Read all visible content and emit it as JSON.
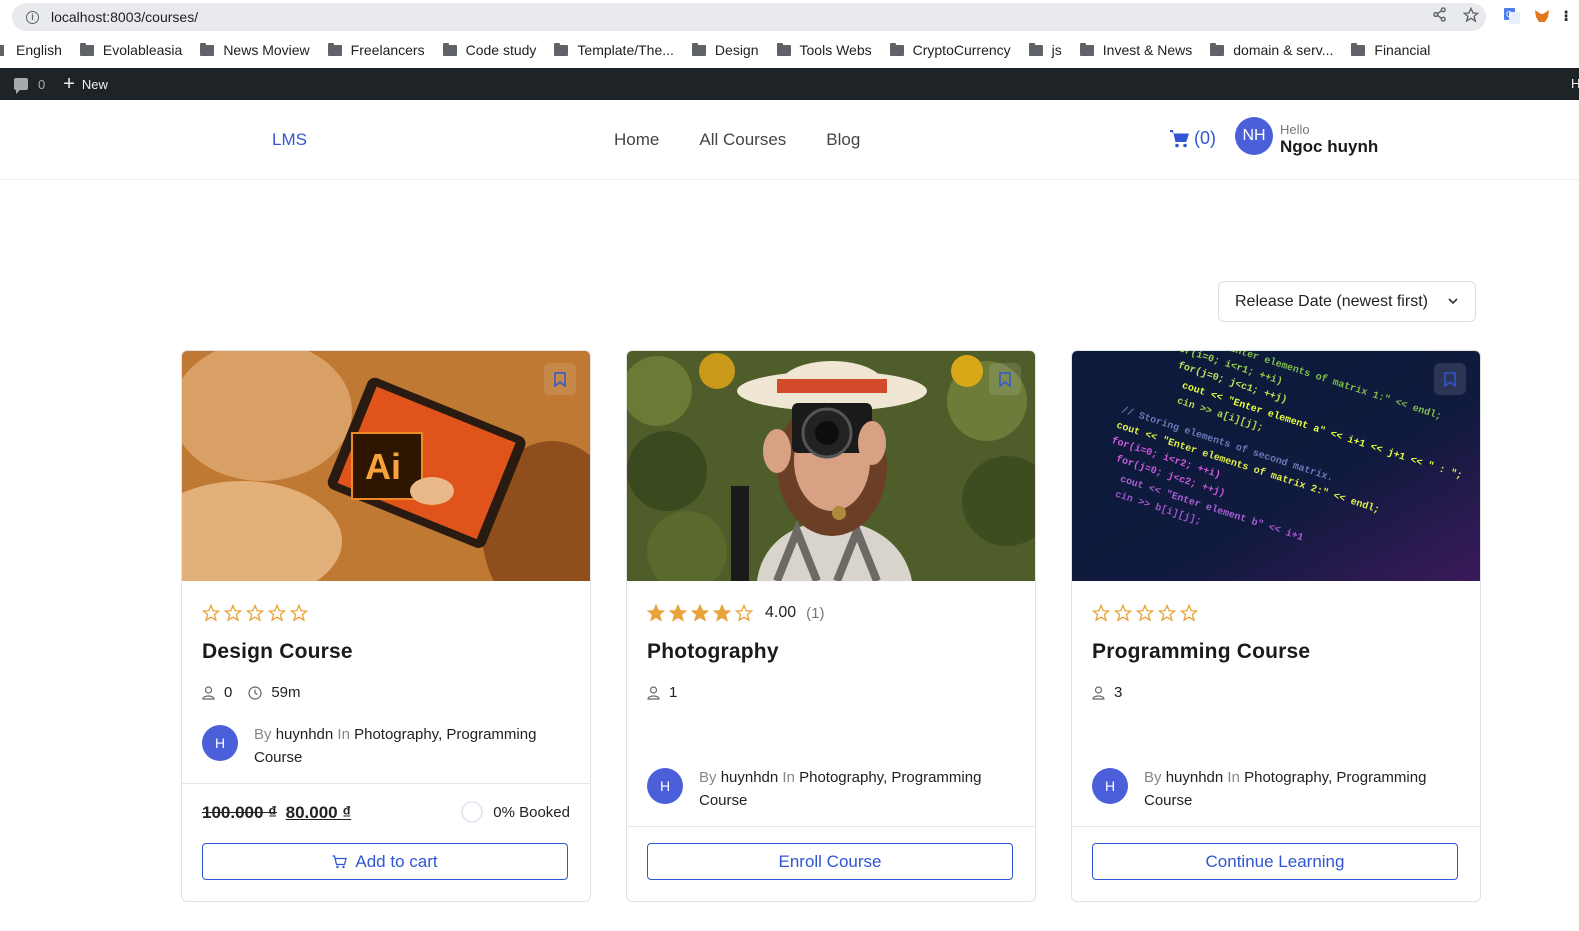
{
  "browser": {
    "url": "localhost:8003/courses/",
    "bookmarks": [
      {
        "label": "English",
        "folder": false
      },
      {
        "label": "Evolableasia",
        "folder": true
      },
      {
        "label": "News Moview",
        "folder": true
      },
      {
        "label": "Freelancers",
        "folder": true
      },
      {
        "label": "Code study",
        "folder": true
      },
      {
        "label": "Template/The...",
        "folder": true
      },
      {
        "label": "Design",
        "folder": true
      },
      {
        "label": "Tools Webs",
        "folder": true
      },
      {
        "label": "CryptoCurrency",
        "folder": true
      },
      {
        "label": "js",
        "folder": true
      },
      {
        "label": "Invest & News",
        "folder": true
      },
      {
        "label": "domain & serv...",
        "folder": true
      },
      {
        "label": "Financial",
        "folder": true
      }
    ]
  },
  "adminbar": {
    "comments_count": "0",
    "new_label": "New",
    "right_edge_text": "H"
  },
  "header": {
    "logo": "LMS",
    "nav": [
      "Home",
      "All Courses",
      "Blog"
    ],
    "cart_count": "(0)",
    "avatar_initials": "NH",
    "greeting": "Hello",
    "user_name": "Ngoc huynh"
  },
  "sort": {
    "selected": "Release Date (newest first)"
  },
  "colors": {
    "primary": "#3056d3",
    "star": "#e8a33b",
    "avatar": "#4a5fd9",
    "adminbar": "#1d2327"
  },
  "courses": [
    {
      "title": "Design Course",
      "stars_filled": 0,
      "rating": "",
      "rating_count": "",
      "students": "0",
      "duration": "59m",
      "author_initial": "H",
      "by_label": "By",
      "author": "huynhdn",
      "in_label": "In",
      "category1": "Photography",
      "category2": "Programming Course",
      "price_old": "100.000 ₫",
      "price_new": "80.000 ₫",
      "booked": "0% Booked",
      "button": "Add to cart"
    },
    {
      "title": "Photography",
      "stars_filled": 4,
      "rating": "4.00",
      "rating_count": "(1)",
      "students": "1",
      "duration": "",
      "author_initial": "H",
      "by_label": "By",
      "author": "huynhdn",
      "in_label": "In",
      "category1": "Photography",
      "category2": "Programming Course",
      "button": "Enroll Course"
    },
    {
      "title": "Programming Course",
      "stars_filled": 0,
      "rating": "",
      "rating_count": "",
      "students": "3",
      "duration": "",
      "author_initial": "H",
      "by_label": "By",
      "author": "huynhdn",
      "in_label": "In",
      "category1": "Photography",
      "category2": "Programming Course",
      "button": "Continue Learning"
    }
  ]
}
